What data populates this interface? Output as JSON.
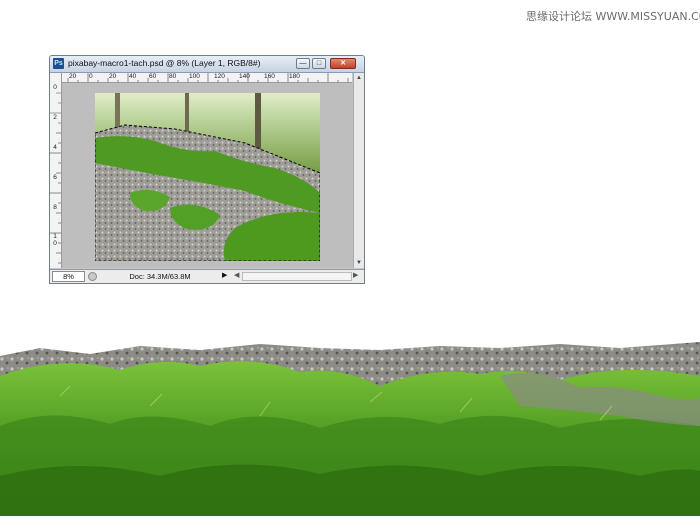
{
  "watermark": "思缘设计论坛 WWW.MISSYUAN.COM",
  "window": {
    "title": "pixabay-macro1-tach.psd @ 8% (Layer 1, RGB/8#)",
    "app_icon_label": "Ps",
    "minimize_glyph": "—",
    "maximize_glyph": "□",
    "close_glyph": "✕"
  },
  "rulers": {
    "horizontal": [
      "20",
      "0",
      "20",
      "40",
      "60",
      "80",
      "100",
      "120",
      "140",
      "160",
      "180"
    ],
    "vertical": [
      "0",
      "2",
      "4",
      "6",
      "8",
      "1 0"
    ]
  },
  "status": {
    "zoom": "8%",
    "doc_info": "Doc: 34.3M/63.8M",
    "menu_arrow": "▶",
    "scroll_left": "◀",
    "scroll_right": "▶"
  },
  "icons": {
    "app": "photoshop-icon",
    "status": "info-icon"
  },
  "colors": {
    "title_gradient_top": "#e8eef6",
    "title_gradient_bottom": "#c6d3e3",
    "close_button": "#c4412a",
    "canvas_bg": "#bebebe",
    "moss_green": "#4e9a2a"
  }
}
